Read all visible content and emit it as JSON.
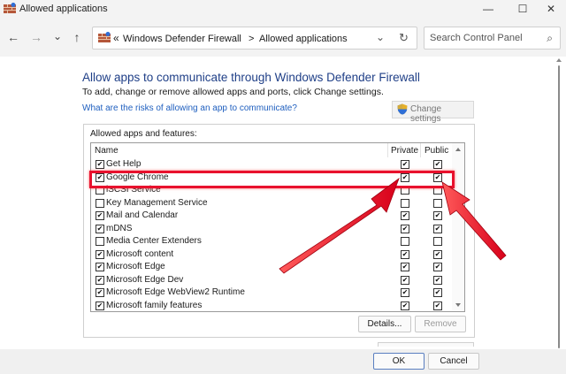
{
  "window": {
    "title": "Allowed applications",
    "minimize_glyph": "—",
    "maximize_glyph": "☐",
    "close_glyph": "✕"
  },
  "nav": {
    "back": "←",
    "forward": "→",
    "recent": "⌄",
    "up": "↑",
    "breadcrumb_sep": "«",
    "crumb_1": "Windows Defender Firewall",
    "crumb_arrow": ">",
    "crumb_2": "Allowed applications",
    "dropdown": "⌄",
    "refresh": "↻",
    "search_placeholder": "Search Control Panel",
    "search_glyph": "⌕"
  },
  "content": {
    "heading": "Allow apps to communicate through Windows Defender Firewall",
    "subtext": "To add, change or remove allowed apps and ports, click Change settings.",
    "risk_link": "What are the risks of allowing an app to communicate?",
    "change_settings": "Change settings",
    "group_label": "Allowed apps and features:",
    "columns": {
      "name": "Name",
      "private": "Private",
      "public": "Public"
    },
    "apps": [
      {
        "name": "Get Help",
        "enabled": true,
        "private": true,
        "public": true
      },
      {
        "name": "Google Chrome",
        "enabled": true,
        "private": true,
        "public": true
      },
      {
        "name": "iSCSI Service",
        "enabled": false,
        "private": false,
        "public": false
      },
      {
        "name": "Key Management Service",
        "enabled": false,
        "private": false,
        "public": false
      },
      {
        "name": "Mail and Calendar",
        "enabled": true,
        "private": true,
        "public": true
      },
      {
        "name": "mDNS",
        "enabled": true,
        "private": true,
        "public": true
      },
      {
        "name": "Media Center Extenders",
        "enabled": false,
        "private": false,
        "public": false
      },
      {
        "name": "Microsoft content",
        "enabled": true,
        "private": true,
        "public": true
      },
      {
        "name": "Microsoft Edge",
        "enabled": true,
        "private": true,
        "public": true
      },
      {
        "name": "Microsoft Edge Dev",
        "enabled": true,
        "private": true,
        "public": true
      },
      {
        "name": "Microsoft Edge WebView2 Runtime",
        "enabled": true,
        "private": true,
        "public": true
      },
      {
        "name": "Microsoft family features",
        "enabled": true,
        "private": true,
        "public": true
      }
    ],
    "details_button": "Details...",
    "remove_button": "Remove"
  },
  "footer": {
    "ok_button": "OK",
    "cancel_button": "Cancel"
  },
  "colors": {
    "highlight": "#e8112d",
    "heading": "#1f3f87",
    "link": "#1f5fbf"
  },
  "checkmark": "✔"
}
